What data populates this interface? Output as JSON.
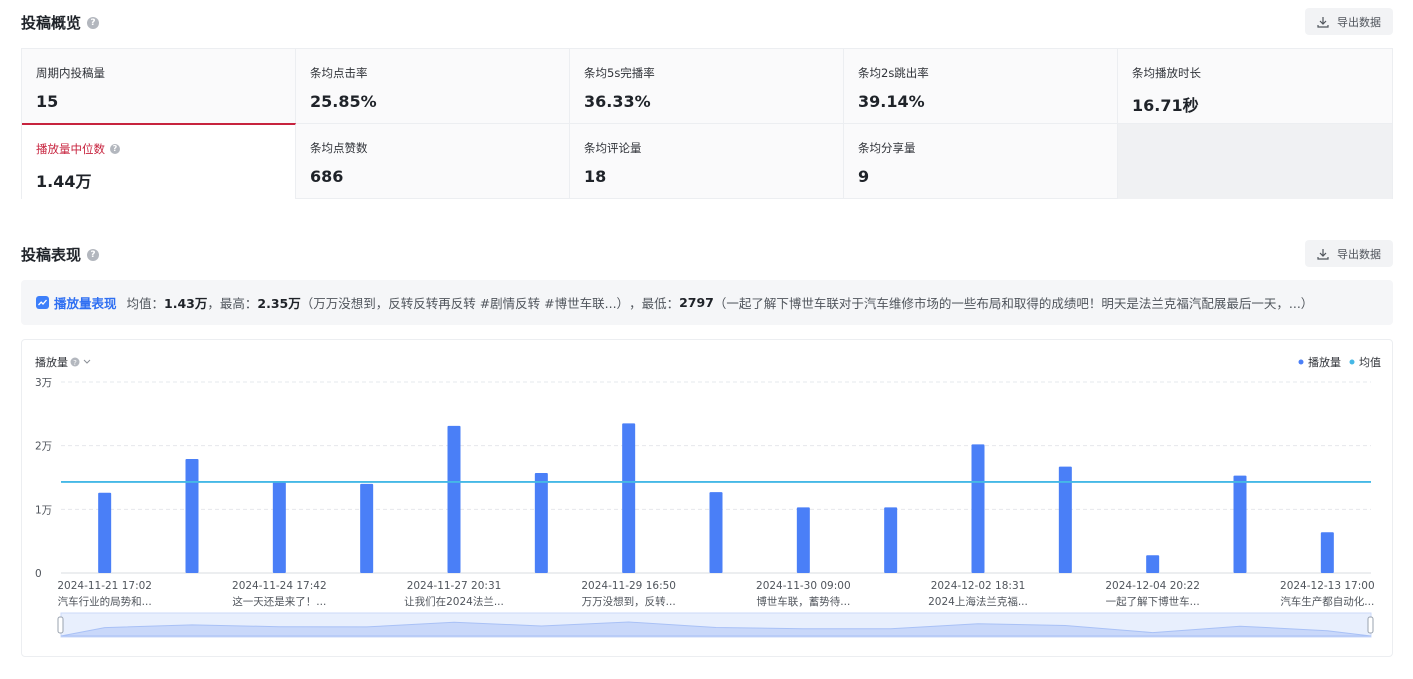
{
  "overview": {
    "title": "投稿概览",
    "export_label": "导出数据",
    "stats": [
      {
        "label": "周期内投稿量",
        "value": "15"
      },
      {
        "label": "条均点击率",
        "value": "25.85%"
      },
      {
        "label": "条均5s完播率",
        "value": "36.33%"
      },
      {
        "label": "条均2s跳出率",
        "value": "39.14%"
      },
      {
        "label": "条均播放时长",
        "value": "16.71秒"
      },
      {
        "label": "播放量中位数",
        "value": "1.44万"
      },
      {
        "label": "条均点赞数",
        "value": "686"
      },
      {
        "label": "条均评论量",
        "value": "18"
      },
      {
        "label": "条均分享量",
        "value": "9"
      }
    ]
  },
  "performance": {
    "title": "投稿表现",
    "export_label": "导出数据",
    "summary": {
      "metric": "播放量表现",
      "avg_label": "均值：",
      "avg_value": "1.43万",
      "max_label": "，最高：",
      "max_value": "2.35万",
      "max_title": "（万万没想到，反转反转再反转 #剧情反转 #博世车联...）",
      "min_label": "，最低：",
      "min_value": "2797",
      "min_title": "（一起了解下博世车联对于汽车维修市场的一些布局和取得的成绩吧！明天是法兰克福汽配展最后一天，...）"
    },
    "metric_selector": "播放量",
    "legend": [
      {
        "name": "播放量",
        "color": "#4a7ff7"
      },
      {
        "name": "均值",
        "color": "#45b8e6"
      }
    ]
  },
  "chart_data": {
    "type": "bar",
    "ylim": [
      0,
      30000
    ],
    "yticks": [
      {
        "value": 0,
        "label": "0"
      },
      {
        "value": 10000,
        "label": "1万"
      },
      {
        "value": 20000,
        "label": "2万"
      },
      {
        "value": 30000,
        "label": "3万"
      }
    ],
    "values": [
      12600,
      17900,
      14300,
      14000,
      23100,
      15700,
      23500,
      12700,
      10300,
      10300,
      20200,
      16700,
      2797,
      15300,
      6400
    ],
    "mean": 14300,
    "x_labels": [
      {
        "index": 0,
        "date": "2024-11-21 17:02",
        "title": "汽车行业的局势和..."
      },
      {
        "index": 2,
        "date": "2024-11-24 17:42",
        "title": "这一天还是来了！..."
      },
      {
        "index": 4,
        "date": "2024-11-27 20:31",
        "title": "让我们在2024法兰..."
      },
      {
        "index": 6,
        "date": "2024-11-29 16:50",
        "title": "万万没想到，反转..."
      },
      {
        "index": 8,
        "date": "2024-11-30 09:00",
        "title": "博世车联，蓄势待..."
      },
      {
        "index": 10,
        "date": "2024-12-02 18:31",
        "title": "2024上海法兰克福..."
      },
      {
        "index": 12,
        "date": "2024-12-04 20:22",
        "title": "一起了解下博世车..."
      },
      {
        "index": 14,
        "date": "2024-12-13 17:00",
        "title": "汽车生产都自动化..."
      }
    ],
    "grid": true,
    "legend_position": "top-right",
    "series_color": "#4a7ff7",
    "mean_color": "#45b8e6"
  }
}
